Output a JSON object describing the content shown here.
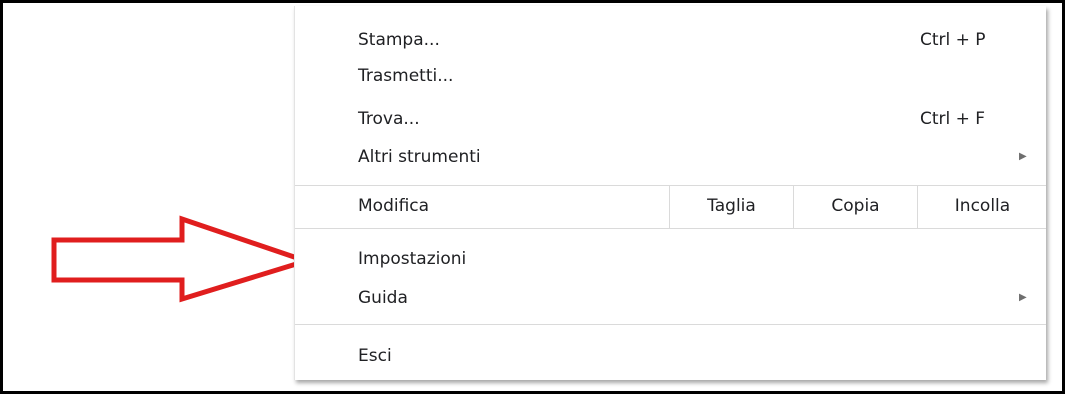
{
  "menu": {
    "items_top": [
      {
        "label": "Stampa...",
        "shortcut": "Ctrl + P"
      },
      {
        "label": "Trasmetti...",
        "shortcut": ""
      },
      {
        "label": "Trova...",
        "shortcut": "Ctrl + F"
      },
      {
        "label": "Altri strumenti",
        "submenu_icon": "submenu-arrow-icon"
      }
    ],
    "edit": {
      "label": "Modifica",
      "cut_label": "Taglia",
      "copy_label": "Copia",
      "paste_label": "Incolla"
    },
    "items_middle": [
      {
        "label": "Impostazioni"
      },
      {
        "label": "Guida",
        "submenu_icon": "submenu-arrow-icon"
      }
    ],
    "items_bottom": [
      {
        "label": "Esci"
      }
    ]
  },
  "annotation": {
    "icon": "red-outline-arrow-icon",
    "color": "#e01e1e"
  }
}
